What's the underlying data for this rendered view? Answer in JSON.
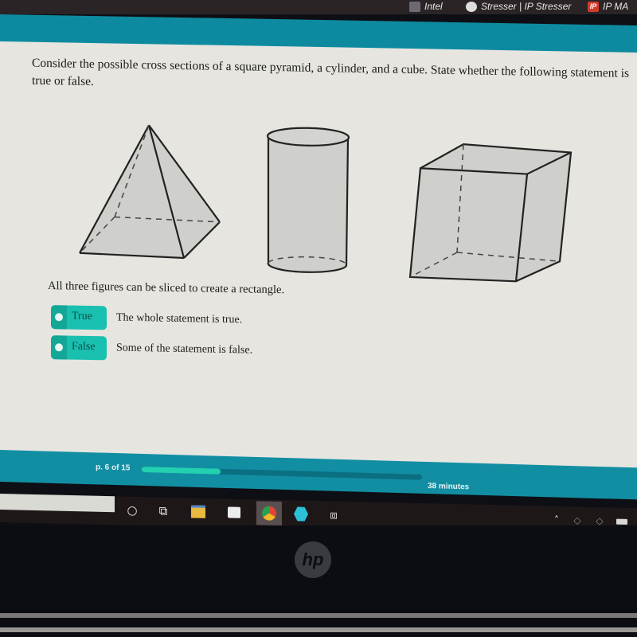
{
  "browser": {
    "bookmarks": [
      {
        "label": "Intel",
        "icon": "x-icon"
      },
      {
        "label": "Stresser | IP Stresser",
        "icon": "stresser-icon"
      },
      {
        "label": "IP MA",
        "icon": "ip-icon",
        "icon_text": "IP"
      }
    ]
  },
  "question": {
    "prompt": "Consider the possible cross sections of a square pyramid, a cylinder, and a cube. State whether the following statement is true or false.",
    "figures": [
      "square pyramid",
      "cylinder",
      "cube"
    ],
    "statement": "All three figures can be sliced to create a rectangle.",
    "options": [
      {
        "label": "True",
        "description": "The whole statement is true."
      },
      {
        "label": "False",
        "description": "Some of the statement is false."
      }
    ]
  },
  "footer": {
    "page_text": "p. 6 of 15",
    "progress_fraction": 0.28,
    "time_text": "38 minutes"
  },
  "taskbar": {
    "icons": [
      "cortana-circle-icon",
      "task-view-icon",
      "file-explorer-icon",
      "store-icon",
      "chrome-icon",
      "app-hexagon-icon",
      "connect-icon"
    ],
    "tray": [
      "chevron-up-icon",
      "network-icon",
      "network-icon-2",
      "battery-icon"
    ]
  },
  "device": {
    "brand": "hp"
  },
  "colors": {
    "accent": "#0e8aa0",
    "option_button": "#19c0b0",
    "progress_fill": "#23d0b0"
  }
}
